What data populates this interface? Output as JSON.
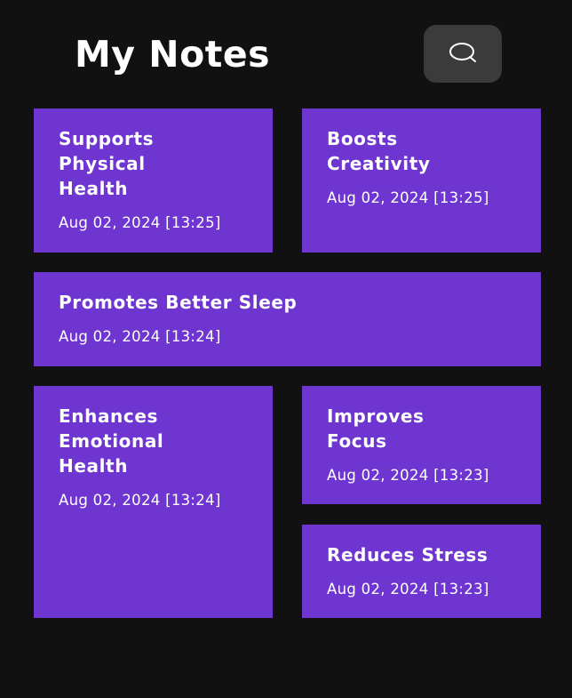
{
  "header": {
    "title": "My Notes"
  },
  "search": {
    "icon": "search-icon"
  },
  "colors": {
    "background": "#111111",
    "card": "#6e35d0",
    "search_button": "#3b3b3b"
  },
  "notes": [
    {
      "title": "Supports\nPhysical\nHealth",
      "date": "Aug 02, 2024 [13:25]"
    },
    {
      "title": "Boosts\nCreativity",
      "date": "Aug 02, 2024 [13:25]"
    },
    {
      "title": "Promotes Better Sleep",
      "date": "Aug 02, 2024 [13:24]"
    },
    {
      "title": "Enhances\nEmotional\nHealth",
      "date": "Aug 02, 2024 [13:24]"
    },
    {
      "title": "Improves\nFocus",
      "date": "Aug 02, 2024 [13:23]"
    },
    {
      "title": "Reduces Stress",
      "date": "Aug 02, 2024 [13:23]"
    }
  ]
}
